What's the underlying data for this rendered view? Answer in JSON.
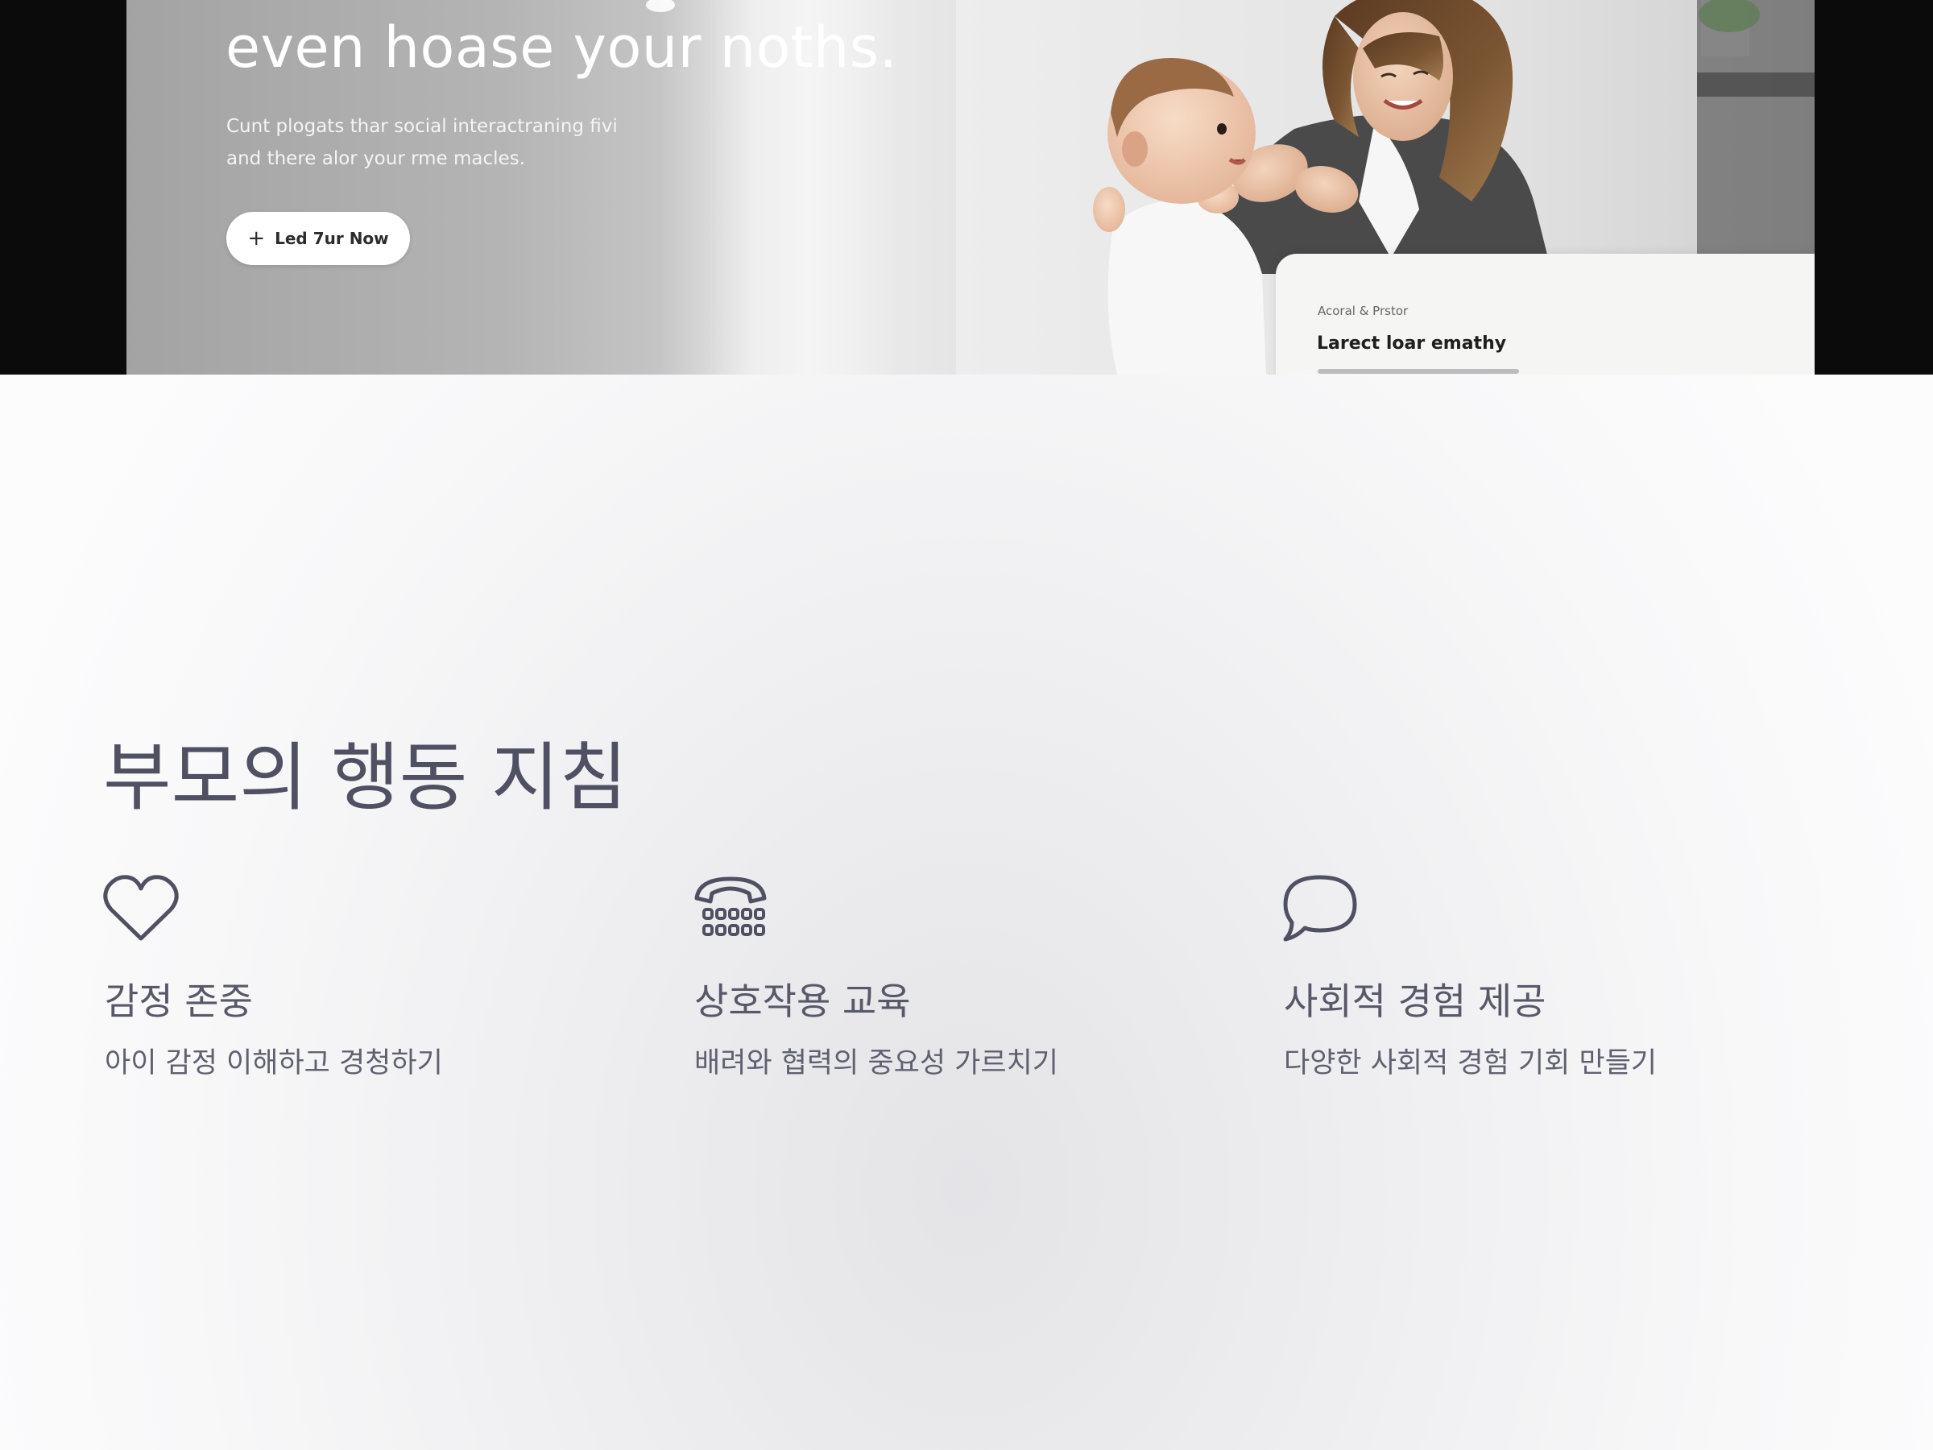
{
  "hero": {
    "heading": "even hoase your noths.",
    "subtitle_lines": [
      "Cunt plogats thar social interactraning fivi",
      "and there alor your rme macles."
    ],
    "cta_label": "Led 7ur Now",
    "cta_icon": "plus-icon",
    "card": {
      "eyebrow": "Acoral & Prstor",
      "title": "Larect loar emathy"
    }
  },
  "guidelines": {
    "title": "부모의 행동 지침",
    "items": [
      {
        "icon": "heart-icon",
        "title": "감정 존중",
        "description": "아이 감정 이해하고 경청하기"
      },
      {
        "icon": "telephone-icon",
        "title": "상호작용 교육",
        "description": "배려와 협력의 중요성 가르치기"
      },
      {
        "icon": "speech-bubble-icon",
        "title": "사회적 경험 제공",
        "description": "다양한 사회적 경험 기회 만들기"
      }
    ]
  },
  "colors": {
    "heading_text": "#4f5162",
    "body_text": "#5f6170",
    "hero_band": "#0b0b0b",
    "cta_background": "#ffffff"
  }
}
